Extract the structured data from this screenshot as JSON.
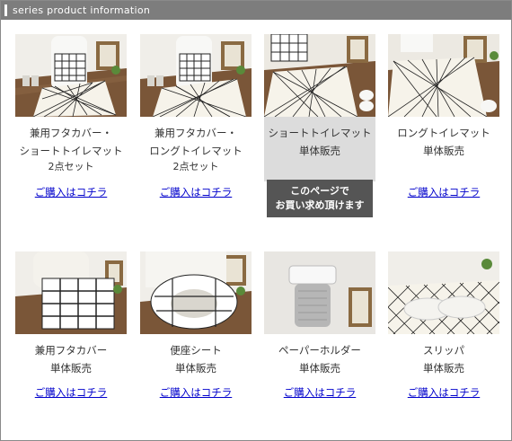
{
  "header": {
    "title": "series product information"
  },
  "products": [
    {
      "name": "兼用フタカバー・",
      "sub": "ショートトイレマット",
      "sub2": "2点セット",
      "link": "ご購入はコチラ",
      "icon": "toilet-lid-cover-short-mat-photo"
    },
    {
      "name": "兼用フタカバー・",
      "sub": "ロングトイレマット",
      "sub2": "2点セット",
      "link": "ご購入はコチラ",
      "icon": "toilet-lid-cover-long-mat-photo"
    },
    {
      "name": "ショートトイレマット",
      "sub": "単体販売",
      "sub2": "",
      "soldout_line1": "このページで",
      "soldout_line2": "お買い求め頂けます",
      "icon": "short-toilet-mat-photo"
    },
    {
      "name": "ロングトイレマット",
      "sub": "単体販売",
      "sub2": "",
      "link": "ご購入はコチラ",
      "icon": "long-toilet-mat-photo"
    },
    {
      "name": "兼用フタカバー",
      "sub": "単体販売",
      "sub2": "",
      "link": "ご購入はコチラ",
      "icon": "lid-cover-photo"
    },
    {
      "name": "便座シート",
      "sub": "単体販売",
      "sub2": "",
      "link": "ご購入はコチラ",
      "icon": "toilet-seat-cover-photo"
    },
    {
      "name": "ペーパーホルダー",
      "sub": "単体販売",
      "sub2": "",
      "link": "ご購入はコチラ",
      "icon": "paper-holder-cover-photo"
    },
    {
      "name": "スリッパ",
      "sub": "単体販売",
      "sub2": "",
      "link": "ご購入はコチラ",
      "icon": "slippers-photo"
    }
  ],
  "colors": {
    "header_bg": "#7d7d7d",
    "link": "#0000cc",
    "soldout_bg": "#555555",
    "highlight_bg": "#dcdcdc"
  }
}
